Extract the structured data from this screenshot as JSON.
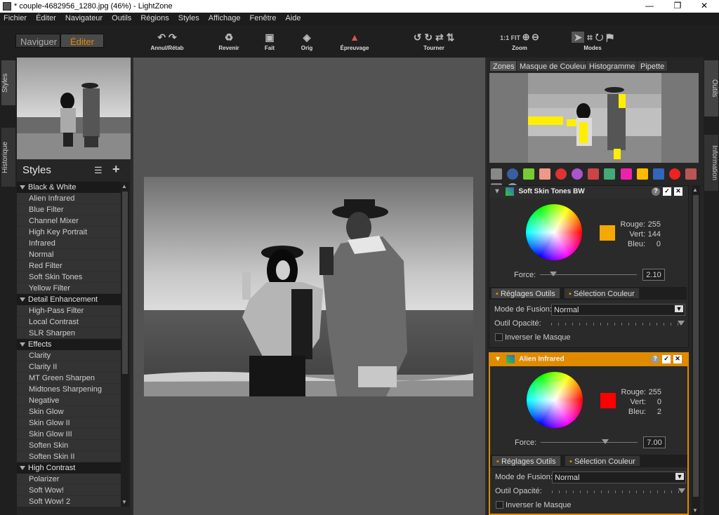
{
  "window": {
    "title": "* couple-4682956_1280.jpg (46%) - LightZone",
    "min": "—",
    "restore": "❐",
    "close": "✕"
  },
  "menu": [
    "Fichier",
    "Éditer",
    "Navigateur",
    "Outils",
    "Régions",
    "Styles",
    "Affichage",
    "Fenêtre",
    "Aide"
  ],
  "modes": {
    "browse": "Naviguer",
    "edit": "Éditer"
  },
  "toolbar": {
    "undo": "Annul/Rétab",
    "revert": "Revenir",
    "done": "Fait",
    "orig": "Orig",
    "proof": "Épreuvage",
    "rotate": "Tourner",
    "zoom": "Zoom",
    "zoom_11": "1:1",
    "zoom_fit": "FIT",
    "modes": "Modes"
  },
  "left_tabs": {
    "styles": "Styles",
    "history": "Historique"
  },
  "right_tabs": {
    "tools": "Outils",
    "info": "Information"
  },
  "styles": {
    "title": "Styles",
    "groups": [
      {
        "name": "Black & White",
        "items": [
          "Alien Infrared",
          "Blue Filter",
          "Channel Mixer",
          "High Key Portrait",
          "Infrared",
          "Normal",
          "Red Filter",
          "Soft Skin Tones",
          "Yellow Filter"
        ]
      },
      {
        "name": "Detail Enhancement",
        "items": [
          "High-Pass Filter",
          "Local Contrast",
          "SLR Sharpen"
        ]
      },
      {
        "name": "Effects",
        "items": [
          "Clarity",
          "Clarity II",
          "MT Green Sharpen",
          "Midtones Sharpening",
          "Negative",
          "Skin Glow",
          "Skin Glow II",
          "Skin Glow III",
          "Soften Skin",
          "Soften Skin II"
        ]
      },
      {
        "name": "High Contrast",
        "items": [
          "Polarizer",
          "Soft Wow!",
          "Soft Wow! 2"
        ]
      }
    ]
  },
  "zone_tabs": [
    "Zones",
    "Masque de Couleur",
    "Histogramme",
    "Pipette"
  ],
  "tools": [
    {
      "name": "Soft Skin Tones BW",
      "rouge_label": "Rouge:",
      "rouge": "255",
      "vert_label": "Vert:",
      "vert": "144",
      "bleu_label": "Bleu:",
      "bleu": "0",
      "swatch": "#f5a800",
      "force_label": "Force:",
      "force": "2.10",
      "force_pos": 0.14,
      "tab1": "Réglages Outils",
      "tab2": "Sélection Couleur",
      "fusion_label": "Mode de Fusion:",
      "fusion": "Normal",
      "opacity_label": "Outil Opacité:",
      "invert": "Inverser le Masque"
    },
    {
      "name": "Alien Infrared",
      "rouge_label": "Rouge:",
      "rouge": "255",
      "vert_label": "Vert:",
      "vert": "0",
      "bleu_label": "Bleu:",
      "bleu": "2",
      "swatch": "#ff0000",
      "force_label": "Force:",
      "force": "7.00",
      "force_pos": 0.67,
      "tab1": "Réglages Outils",
      "tab2": "Sélection Couleur",
      "fusion_label": "Mode de Fusion:",
      "fusion": "Normal",
      "opacity_label": "Outil Opacité:",
      "invert": "Inverser le Masque"
    }
  ]
}
